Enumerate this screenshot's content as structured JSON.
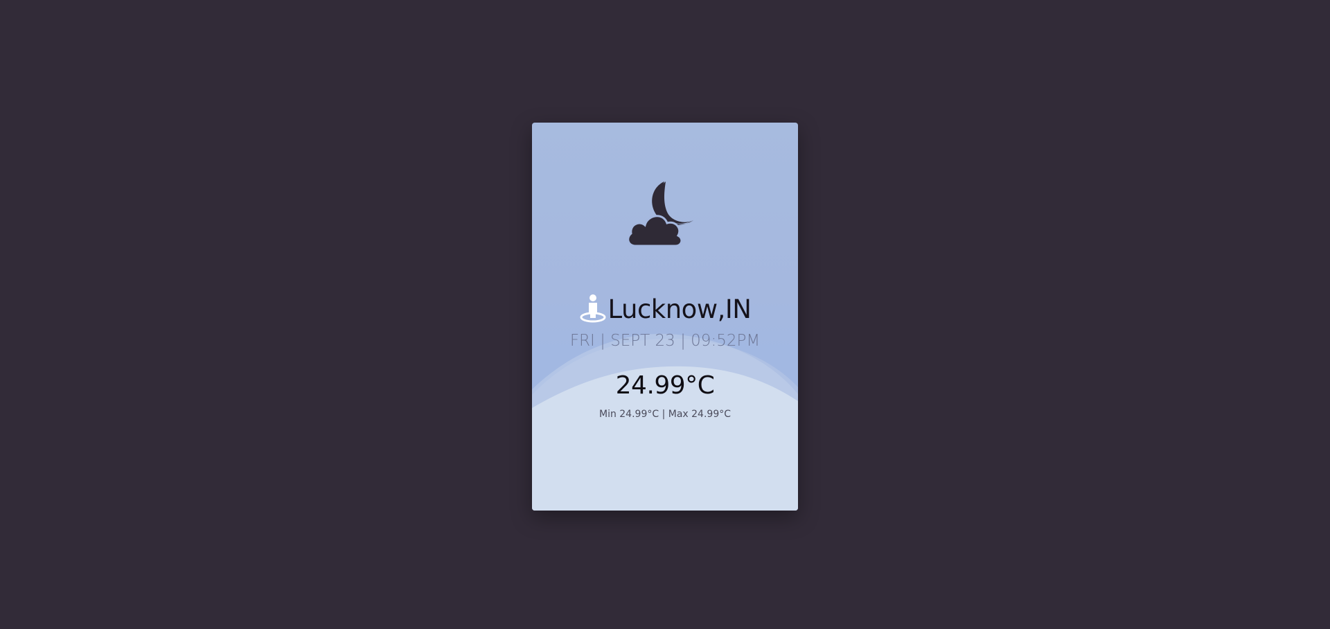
{
  "weather": {
    "condition_icon": "moon-cloud-icon",
    "location_icon": "location-person-icon",
    "city": "Lucknow,IN",
    "datetime": "FRI | SEPT 23 | 09:52PM",
    "temperature": "24.99°C",
    "minmax": "Min 24.99°C | Max 24.99°C"
  },
  "colors": {
    "background": "#322b38",
    "card_top": "#a7bbdf",
    "card_wave": "#d2deef",
    "icon": "#2f2a36"
  }
}
